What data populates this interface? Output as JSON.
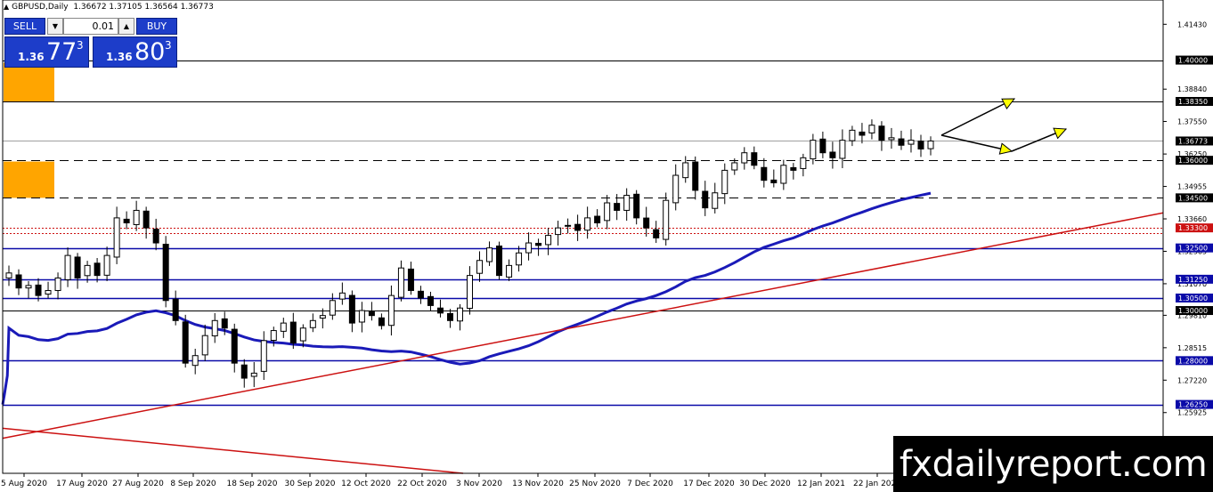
{
  "header": {
    "symbol": "GBPUSD,Daily",
    "ohlc": "1.36672 1.37105 1.36564 1.36773"
  },
  "trade_panel": {
    "sell_label": "SELL",
    "buy_label": "BUY",
    "lot": "0.01",
    "bid": {
      "prefix": "1.36",
      "big": "77",
      "sup": "3"
    },
    "ask": {
      "prefix": "1.36",
      "big": "80",
      "sup": "3"
    }
  },
  "watermark": "fxdailyreport.com",
  "colors": {
    "bull": "#ffffff",
    "bear": "#000000",
    "ma": "#1a1ab8",
    "trendline": "#cc1111",
    "support_blue": "#0a0aa8",
    "zone": "#ffa500",
    "arrow": "#ffff00"
  },
  "chart_data": {
    "type": "candlestick",
    "symbol": "GBPUSD",
    "timeframe": "Daily",
    "ylim": [
      1.235,
      1.424
    ],
    "y_ticks": [
      "1.41430",
      "1.38840",
      "1.37550",
      "1.36250",
      "1.34955",
      "1.33660",
      "1.32365",
      "1.31070",
      "1.29810",
      "1.28515",
      "1.27220",
      "1.25925",
      "1.24630"
    ],
    "x_ticks": [
      "5 Aug 2020",
      "17 Aug 2020",
      "27 Aug 2020",
      "8 Sep 2020",
      "18 Sep 2020",
      "30 Sep 2020",
      "12 Oct 2020",
      "22 Oct 2020",
      "3 Nov 2020",
      "13 Nov 2020",
      "25 Nov 2020",
      "7 Dec 2020",
      "17 Dec 2020",
      "30 Dec 2020",
      "12 Jan 2021",
      "22 Jan 2021"
    ],
    "close_path": [
      1.315,
      1.309,
      1.31,
      1.306,
      1.308,
      1.313,
      1.322,
      1.313,
      1.318,
      1.314,
      1.322,
      1.337,
      1.335,
      1.34,
      1.333,
      1.327,
      1.304,
      1.296,
      1.279,
      1.282,
      1.29,
      1.296,
      1.293,
      1.279,
      1.273,
      1.275,
      1.288,
      1.292,
      1.295,
      1.287,
      1.293,
      1.296,
      1.298,
      1.304,
      1.307,
      1.295,
      1.3,
      1.298,
      1.294,
      1.306,
      1.317,
      1.308,
      1.305,
      1.302,
      1.299,
      1.296,
      1.301,
      1.314,
      1.32,
      1.325,
      1.314,
      1.318,
      1.323,
      1.327,
      1.326,
      1.33,
      1.333,
      1.334,
      1.332,
      1.337,
      1.335,
      1.343,
      1.34,
      1.346,
      1.337,
      1.333,
      1.329,
      1.344,
      1.354,
      1.359,
      1.348,
      1.341,
      1.347,
      1.356,
      1.359,
      1.363,
      1.358,
      1.352,
      1.351,
      1.358,
      1.356,
      1.361,
      1.368,
      1.363,
      1.361,
      1.368,
      1.372,
      1.37,
      1.374,
      1.368,
      1.369,
      1.366,
      1.368,
      1.3645,
      1.3677
    ],
    "horizontal_levels": [
      {
        "value": 1.4,
        "label": "1.40000",
        "style": "solid",
        "color": "#000000"
      },
      {
        "value": 1.3835,
        "label": "1.38350",
        "style": "solid",
        "color": "#000000"
      },
      {
        "value": 1.3677,
        "label": "1.36773",
        "style": "solid",
        "color": "#a0a0a0"
      },
      {
        "value": 1.36,
        "label": "1.36000",
        "style": "dashed",
        "color": "#000000"
      },
      {
        "value": 1.345,
        "label": "1.34500",
        "style": "dashed",
        "color": "#000000"
      },
      {
        "value": 1.333,
        "label": "1.33300",
        "style": "dotted",
        "color": "#cc1111"
      },
      {
        "value": 1.325,
        "label": "1.32500",
        "style": "solid",
        "color": "#0a0aa8"
      },
      {
        "value": 1.3125,
        "label": "1.31250",
        "style": "solid",
        "color": "#0a0aa8"
      },
      {
        "value": 1.305,
        "label": "1.30500",
        "style": "solid",
        "color": "#0a0aa8"
      },
      {
        "value": 1.3,
        "label": "1.30000",
        "style": "solid",
        "color": "#000000"
      },
      {
        "value": 1.28,
        "label": "1.28000",
        "style": "solid",
        "color": "#0a0aa8"
      },
      {
        "value": 1.2625,
        "label": "1.26250",
        "style": "solid",
        "color": "#0a0aa8"
      }
    ],
    "zones": [
      {
        "top": 1.399,
        "bottom": 1.3835
      },
      {
        "top": 1.3595,
        "bottom": 1.345
      }
    ]
  }
}
